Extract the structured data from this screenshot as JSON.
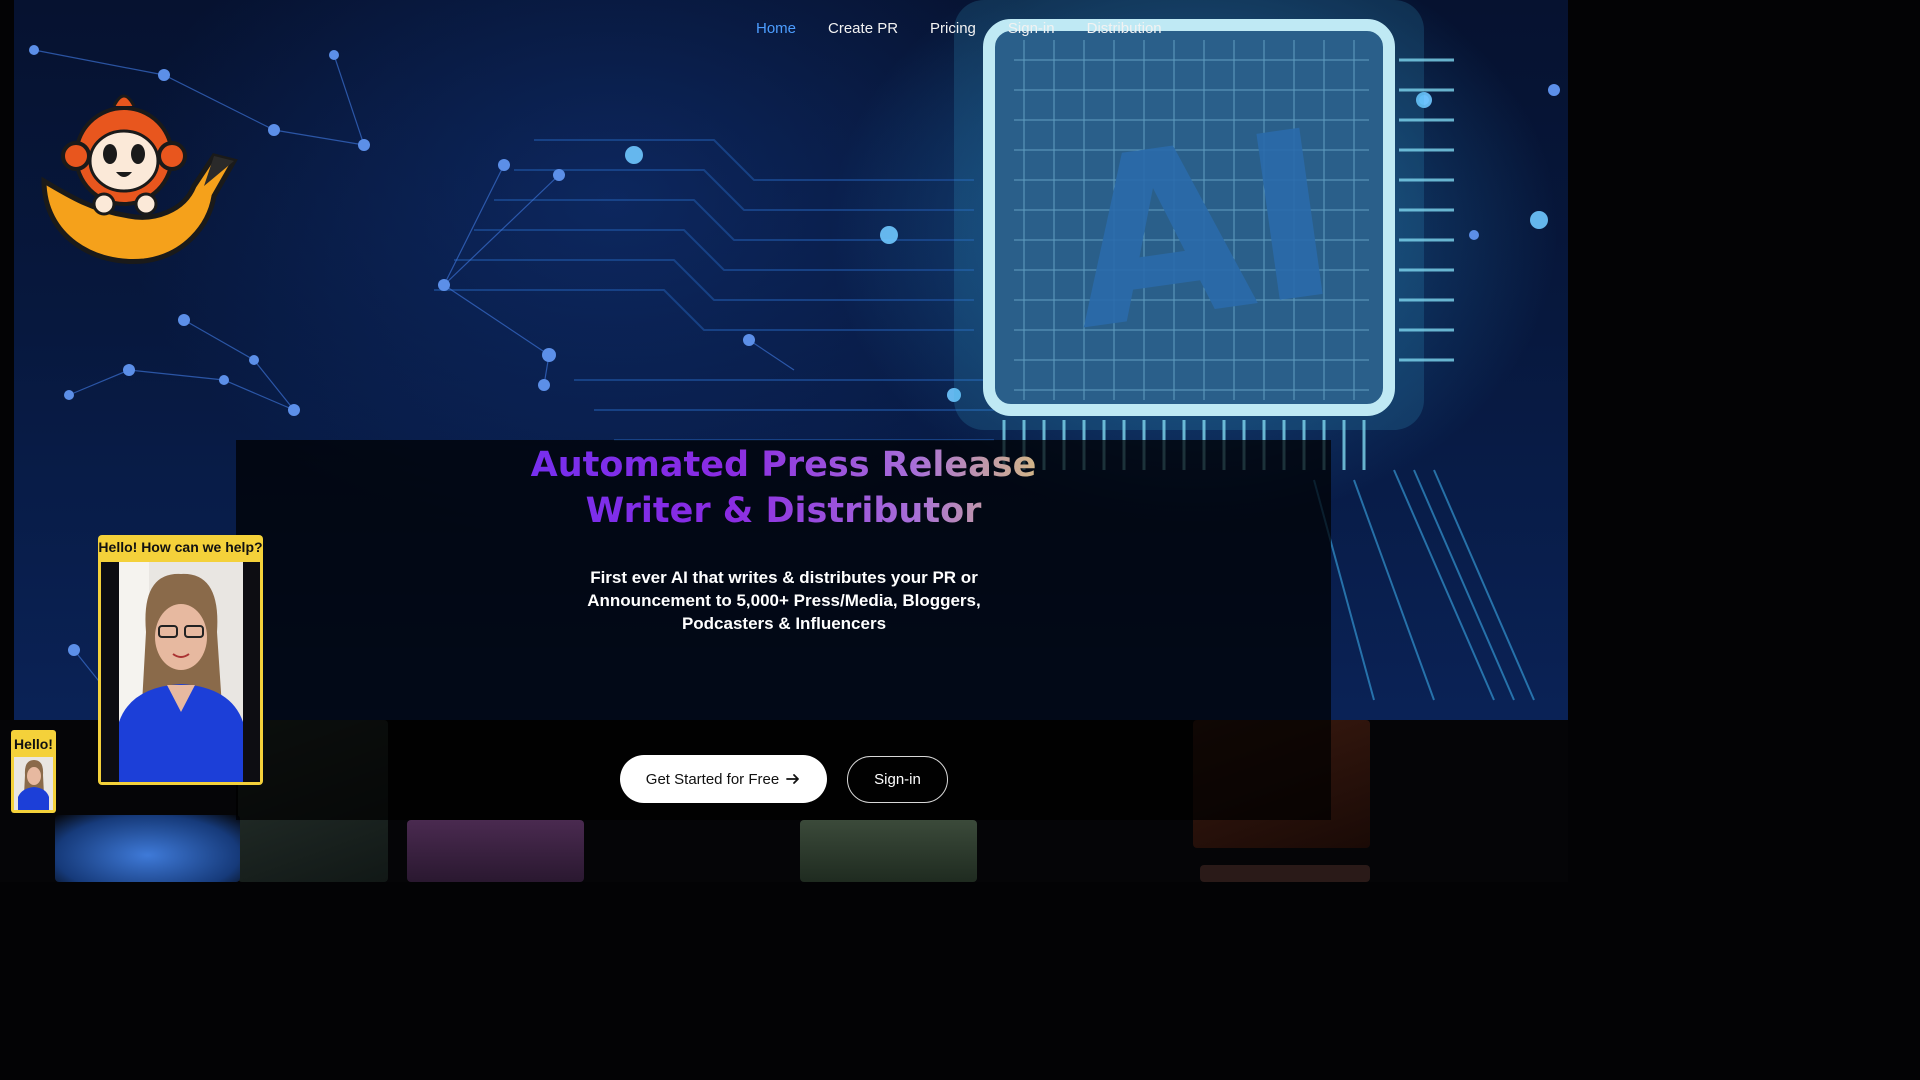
{
  "nav": {
    "items": [
      {
        "label": "Home",
        "active": true
      },
      {
        "label": "Create PR",
        "active": false
      },
      {
        "label": "Pricing",
        "active": false
      },
      {
        "label": "Sign-in",
        "active": false
      },
      {
        "label": "Distribution",
        "active": false
      }
    ]
  },
  "logo": {
    "icon": "monkey-banana-logo-icon"
  },
  "hero": {
    "background_text": "AI",
    "headline_line1": "Automated Press Release",
    "headline_line2": "Writer & Distributor",
    "subtext": "First ever AI that writes & distributes your PR or Announcement  to 5,000+ Press/Media, Bloggers, Podcasters & Influencers",
    "primary_button": "Get Started for Free",
    "primary_button_icon": "arrow-right-icon",
    "secondary_button": "Sign-in"
  },
  "chat_widget": {
    "large_label": "Hello! How can we help?",
    "small_label": "Hello!"
  },
  "colors": {
    "nav_active": "#4c9dff",
    "chat_widget": "#f4d13a",
    "headline_gradient_start": "#5a35ff",
    "headline_gradient_end": "#d9c27a"
  }
}
